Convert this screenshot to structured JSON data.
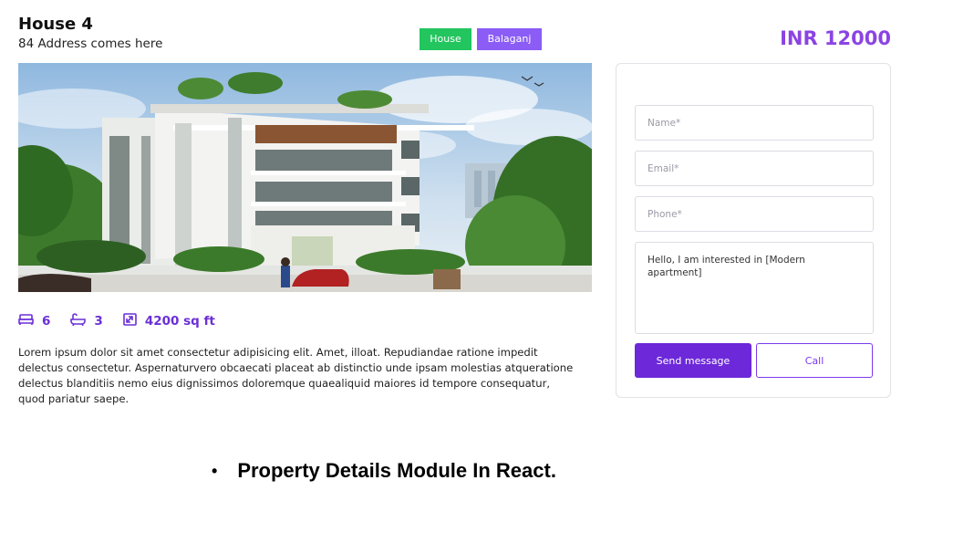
{
  "property": {
    "title": "House 4",
    "address": "84 Address comes here",
    "price": "INR 12000",
    "tags": [
      "House",
      "Balaganj"
    ],
    "features": {
      "bedrooms": "6",
      "bathrooms": "3",
      "area": "4200 sq ft"
    },
    "description": "Lorem ipsum dolor sit amet consectetur adipisicing elit. Amet, illoat. Repudiandae ratione impedit delectus consectetur. Aspernaturvero obcaecati placeat ab distinctio unde ipsam molestias atqueratione delectus blanditiis nemo eius dignissimos doloremque quaealiquid maiores id tempore consequatur, quod pariatur saepe."
  },
  "contact_form": {
    "name_placeholder": "Name*",
    "email_placeholder": "Email*",
    "phone_placeholder": "Phone*",
    "message_value": "Hello, I am interested in [Modern apartment]",
    "send_label": "Send message",
    "call_label": "Call"
  },
  "caption": "Property Details Module In React.",
  "icons": {
    "bed": "bed-icon",
    "bath": "bath-icon",
    "area": "area-icon"
  },
  "colors": {
    "accent": "#6d28d9",
    "price": "#8b44e3",
    "tag_house": "#22c55e",
    "tag_area": "#8b5cf6"
  }
}
